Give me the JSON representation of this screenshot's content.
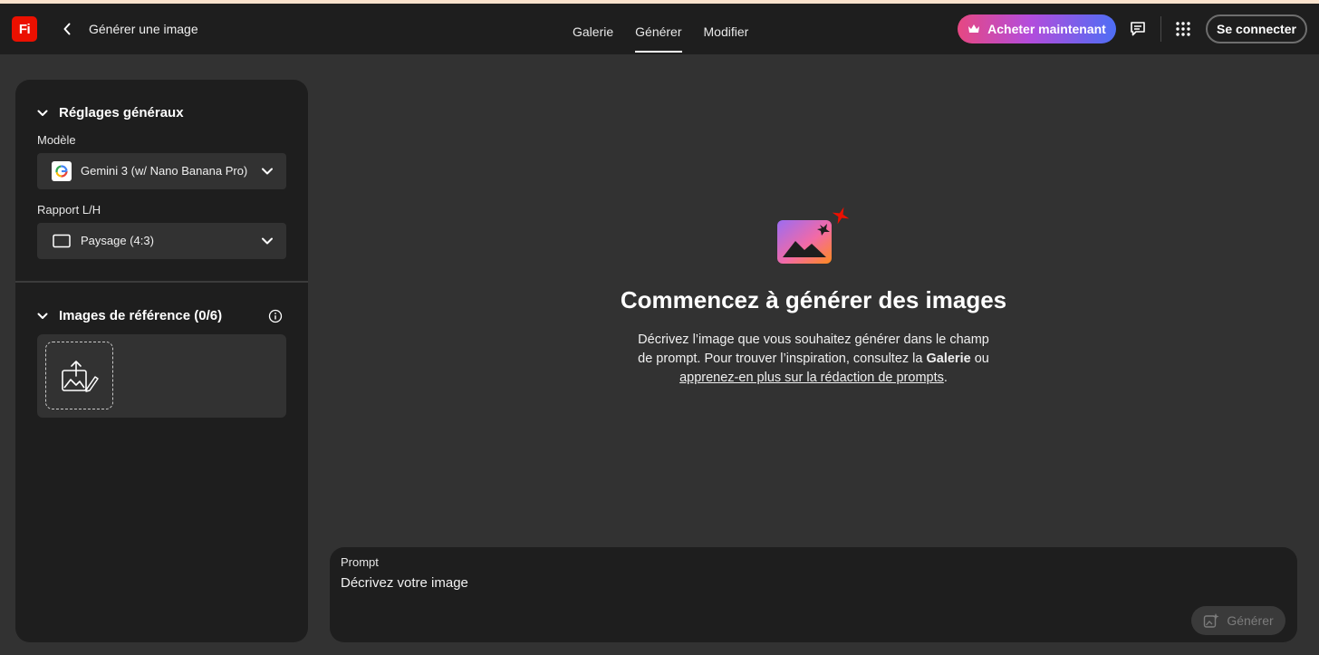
{
  "app": {
    "logo_text": "Fi",
    "page_title": "Générer une image"
  },
  "nav": {
    "tabs": [
      {
        "label": "Galerie"
      },
      {
        "label": "Générer",
        "active": true
      },
      {
        "label": "Modifier"
      }
    ]
  },
  "header": {
    "buy_label": "Acheter maintenant",
    "signin_label": "Se connecter"
  },
  "settings": {
    "title": "Réglages généraux",
    "model_label": "Modèle",
    "model_value": "Gemini 3 (w/ Nano Banana Pro)",
    "ratio_label": "Rapport L/H",
    "ratio_value": "Paysage (4:3)"
  },
  "references": {
    "title": "Images de référence (0/6)"
  },
  "hero": {
    "title": "Commencez à générer des images",
    "desc_line1": "Décrivez l’image que vous souhaitez générer dans le champ",
    "desc_line2_pre": "de prompt. Pour trouver l’inspiration, consultez la ",
    "desc_gallery": "Galerie",
    "desc_or": " ou",
    "desc_link": "apprenez-en plus sur la rédaction de prompts",
    "desc_end": "."
  },
  "prompt": {
    "label": "Prompt",
    "placeholder": "Décrivez votre image",
    "generate_label": "Générer"
  },
  "colors": {
    "brand": "#eb1000",
    "panel": "#1e1e1e",
    "canvas": "#323232",
    "buy_gradient_start": "#e64882",
    "buy_gradient_end": "#4d6ef5"
  },
  "icons": [
    "chevron-left-icon",
    "crown-icon",
    "feedback-icon",
    "apps-grid-icon",
    "chevron-down-icon",
    "google-icon",
    "landscape-ratio-icon",
    "info-icon",
    "image-upload-icon",
    "generate-sparkle-icon"
  ]
}
